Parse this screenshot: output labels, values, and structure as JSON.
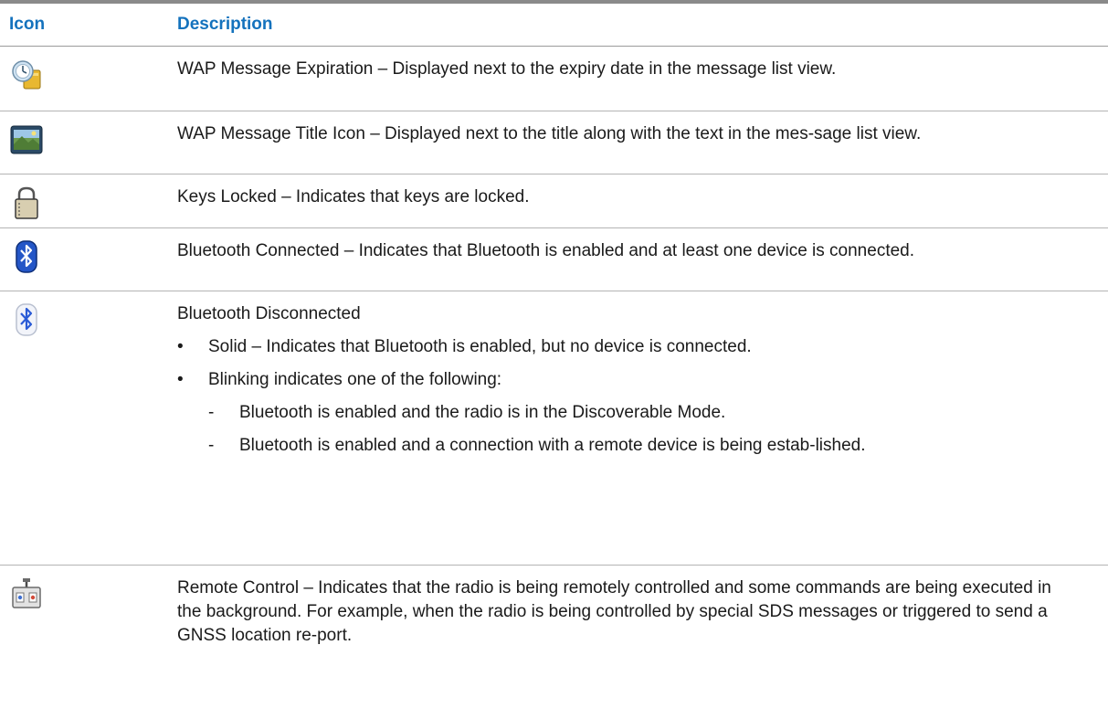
{
  "table": {
    "header": {
      "icon": "Icon",
      "description": "Description"
    },
    "rows": [
      {
        "icon": "wap-message-expiration-icon",
        "description": "WAP Message Expiration – Displayed next to the expiry date in the message list view."
      },
      {
        "icon": "wap-message-title-icon",
        "description": "WAP Message Title Icon – Displayed next to the title along with the text in the mes-sage list view."
      },
      {
        "icon": "keys-locked-icon",
        "description": "Keys Locked – Indicates that keys are locked."
      },
      {
        "icon": "bluetooth-connected-icon",
        "description": "Bluetooth Connected – Indicates that Bluetooth is enabled and at least one device is connected."
      },
      {
        "icon": "bluetooth-disconnected-icon",
        "description": "Bluetooth Disconnected",
        "bullets": [
          {
            "mark": "•",
            "text": "Solid – Indicates that Bluetooth is enabled, but no device is connected."
          },
          {
            "mark": "•",
            "text": "Blinking indicates one of the following:",
            "dashes": [
              {
                "mark": "-",
                "text": "Bluetooth is enabled and the radio is in the Discoverable Mode."
              },
              {
                "mark": "-",
                "text": "Bluetooth is enabled and a connection with a remote device is being estab-lished."
              }
            ]
          }
        ]
      },
      {
        "icon": "remote-control-icon",
        "description": "Remote Control – Indicates that the radio is being remotely controlled and some commands are being executed in the background. For example, when the radio is being controlled by special SDS messages or triggered to send a GNSS location re-port."
      }
    ]
  },
  "colors": {
    "header_text": "#1472bd",
    "rule": "#8a8a8a"
  }
}
